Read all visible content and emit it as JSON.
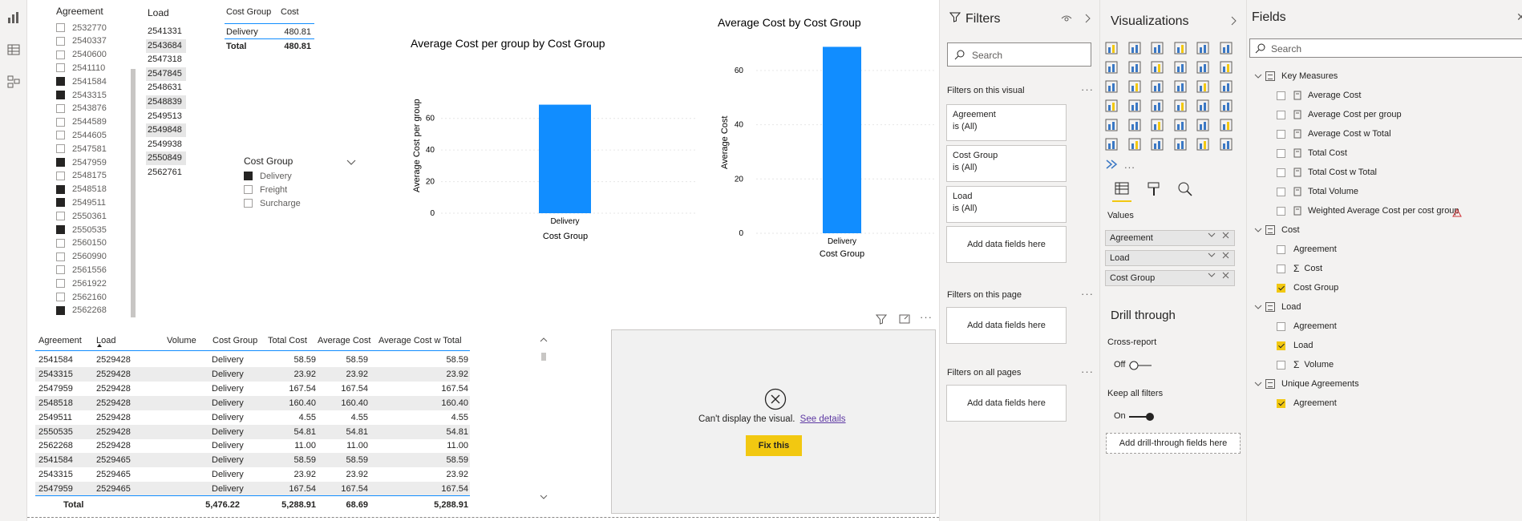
{
  "agreement_slicer": {
    "title": "Agreement",
    "items": [
      {
        "label": "2532770",
        "checked": false
      },
      {
        "label": "2540337",
        "checked": false
      },
      {
        "label": "2540600",
        "checked": false
      },
      {
        "label": "2541110",
        "checked": false
      },
      {
        "label": "2541584",
        "checked": true
      },
      {
        "label": "2543315",
        "checked": true
      },
      {
        "label": "2543876",
        "checked": false
      },
      {
        "label": "2544589",
        "checked": false
      },
      {
        "label": "2544605",
        "checked": false
      },
      {
        "label": "2547581",
        "checked": false
      },
      {
        "label": "2547959",
        "checked": true
      },
      {
        "label": "2548175",
        "checked": false
      },
      {
        "label": "2548518",
        "checked": true
      },
      {
        "label": "2549511",
        "checked": true
      },
      {
        "label": "2550361",
        "checked": false
      },
      {
        "label": "2550535",
        "checked": true
      },
      {
        "label": "2560150",
        "checked": false
      },
      {
        "label": "2560990",
        "checked": false
      },
      {
        "label": "2561556",
        "checked": false
      },
      {
        "label": "2561922",
        "checked": false
      },
      {
        "label": "2562160",
        "checked": false
      },
      {
        "label": "2562268",
        "checked": true
      }
    ]
  },
  "load_table": {
    "title": "Load",
    "items": [
      {
        "label": "2541331",
        "hl": false
      },
      {
        "label": "2543684",
        "hl": true
      },
      {
        "label": "2547318",
        "hl": false
      },
      {
        "label": "2547845",
        "hl": true
      },
      {
        "label": "2548631",
        "hl": false
      },
      {
        "label": "2548839",
        "hl": true
      },
      {
        "label": "2549513",
        "hl": false
      },
      {
        "label": "2549848",
        "hl": true
      },
      {
        "label": "2549938",
        "hl": false
      },
      {
        "label": "2550849",
        "hl": true
      },
      {
        "label": "2562761",
        "hl": false
      }
    ]
  },
  "cost_table": {
    "headers": [
      "Cost Group",
      "Cost"
    ],
    "row": [
      "Delivery",
      "480.81"
    ],
    "total": [
      "Total",
      "480.81"
    ]
  },
  "cost_group_slicer": {
    "title": "Cost Group",
    "items": [
      {
        "label": "Delivery",
        "checked": true
      },
      {
        "label": "Freight",
        "checked": false
      },
      {
        "label": "Surcharge",
        "checked": false
      }
    ]
  },
  "chart_data": [
    {
      "type": "bar",
      "title": "Average Cost per group by Cost Group",
      "xlabel": "Cost Group",
      "ylabel": "Average Cost per group",
      "categories": [
        "Delivery"
      ],
      "values": [
        68.69
      ],
      "ylim": [
        0,
        70
      ],
      "yticks": [
        "0",
        "20",
        "40",
        "60"
      ],
      "color": "#118dff",
      "grid": true
    },
    {
      "type": "bar",
      "title": "Average Cost by Cost Group",
      "xlabel": "Cost Group",
      "ylabel": "Average Cost",
      "categories": [
        "Delivery"
      ],
      "values": [
        68.69
      ],
      "ylim": [
        0,
        70
      ],
      "yticks": [
        "0",
        "20",
        "40",
        "60"
      ],
      "color": "#118dff",
      "grid": true
    }
  ],
  "detail_table": {
    "headers": [
      "Agreement",
      "Load",
      "Volume",
      "Cost Group",
      "Total Cost",
      "Average Cost",
      "Average Cost w Total"
    ],
    "rows": [
      [
        "2541584",
        "2529428",
        "",
        "Delivery",
        "58.59",
        "58.59",
        "58.59"
      ],
      [
        "2543315",
        "2529428",
        "",
        "Delivery",
        "23.92",
        "23.92",
        "23.92"
      ],
      [
        "2547959",
        "2529428",
        "",
        "Delivery",
        "167.54",
        "167.54",
        "167.54"
      ],
      [
        "2548518",
        "2529428",
        "",
        "Delivery",
        "160.40",
        "160.40",
        "160.40"
      ],
      [
        "2549511",
        "2529428",
        "",
        "Delivery",
        "4.55",
        "4.55",
        "4.55"
      ],
      [
        "2550535",
        "2529428",
        "",
        "Delivery",
        "54.81",
        "54.81",
        "54.81"
      ],
      [
        "2562268",
        "2529428",
        "",
        "Delivery",
        "11.00",
        "11.00",
        "11.00"
      ],
      [
        "2541584",
        "2529465",
        "",
        "Delivery",
        "58.59",
        "58.59",
        "58.59"
      ],
      [
        "2543315",
        "2529465",
        "",
        "Delivery",
        "23.92",
        "23.92",
        "23.92"
      ],
      [
        "2547959",
        "2529465",
        "",
        "Delivery",
        "167.54",
        "167.54",
        "167.54"
      ]
    ],
    "total": [
      "Total",
      "",
      "5,476.22",
      "",
      "5,288.91",
      "68.69",
      "5,288.91"
    ]
  },
  "error_visual": {
    "message": "Can't display the visual.",
    "link": "See details",
    "button": "Fix this"
  },
  "filters_pane": {
    "title": "Filters",
    "search_placeholder": "Search",
    "on_visual": "Filters on this visual",
    "cards": [
      {
        "name": "Agreement",
        "state": "is (All)"
      },
      {
        "name": "Cost Group",
        "state": "is (All)"
      },
      {
        "name": "Load",
        "state": "is (All)"
      }
    ],
    "add_fields": "Add data fields here",
    "on_page": "Filters on this page",
    "on_all": "Filters on all pages"
  },
  "viz_pane": {
    "title": "Visualizations",
    "values_label": "Values",
    "wells": [
      "Agreement",
      "Load",
      "Cost Group"
    ],
    "drill_title": "Drill through",
    "cross_report": "Cross-report",
    "cross_state": "Off",
    "keep_filters": "Keep all filters",
    "keep_state": "On",
    "add_drill": "Add drill-through fields here",
    "more": "..."
  },
  "fields_pane": {
    "title": "Fields",
    "search_placeholder": "Search",
    "tables": [
      {
        "name": "Key Measures",
        "items": [
          {
            "label": "Average Cost",
            "checked": false
          },
          {
            "label": "Average Cost per group",
            "checked": false
          },
          {
            "label": "Average Cost w Total",
            "checked": false
          },
          {
            "label": "Total Cost",
            "checked": false
          },
          {
            "label": "Total Cost w Total",
            "checked": false
          },
          {
            "label": "Total Volume",
            "checked": false
          },
          {
            "label": "Weighted Average Cost per cost group",
            "checked": false
          }
        ]
      },
      {
        "name": "Cost",
        "items": [
          {
            "label": "Agreement",
            "checked": false
          },
          {
            "label": "Cost",
            "checked": false,
            "sigma": true
          },
          {
            "label": "Cost Group",
            "checked": true
          }
        ]
      },
      {
        "name": "Load",
        "items": [
          {
            "label": "Agreement",
            "checked": false
          },
          {
            "label": "Load",
            "checked": true
          },
          {
            "label": "Volume",
            "checked": false,
            "sigma": true
          }
        ]
      },
      {
        "name": "Unique Agreements",
        "items": [
          {
            "label": "Agreement",
            "checked": true
          }
        ]
      }
    ]
  }
}
